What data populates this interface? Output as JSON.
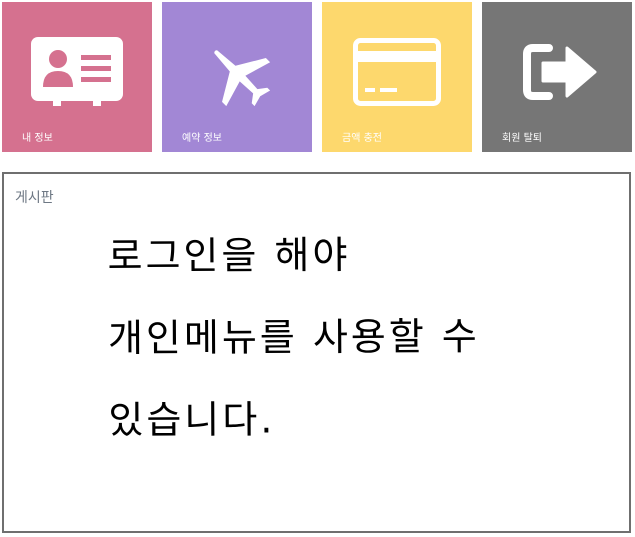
{
  "menu": {
    "tiles": [
      {
        "label": "내 정보",
        "icon": "id-card-icon",
        "color": "#d5718f"
      },
      {
        "label": "예약 정보",
        "icon": "airplane-icon",
        "color": "#a287d5"
      },
      {
        "label": "금액 충전",
        "icon": "credit-card-icon",
        "color": "#fdd86d"
      },
      {
        "label": "회원 탈퇴",
        "icon": "sign-out-icon",
        "color": "#767676"
      }
    ]
  },
  "board": {
    "title": "게시판",
    "message_lines": [
      "로그인을 해야",
      "개인메뉴를 사용할 수",
      "있습니다."
    ]
  }
}
